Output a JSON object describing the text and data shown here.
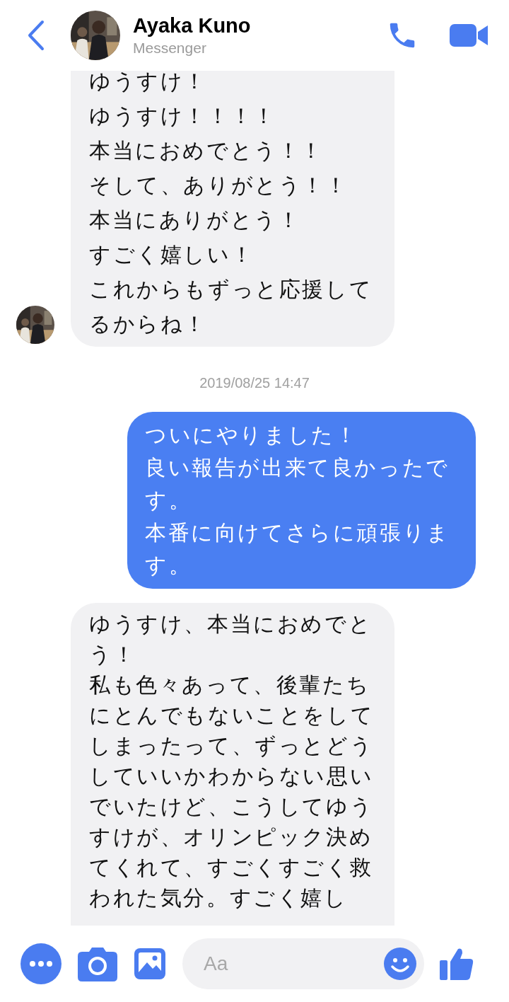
{
  "header": {
    "name": "Ayaka Kuno",
    "subtitle": "Messenger"
  },
  "messages": [
    {
      "kind": "received",
      "avatar": true,
      "lines": [
        "ゆうすけ！",
        "ゆうすけ！！！！",
        "本当におめでとう！！",
        "そして、ありがとう！！",
        "本当にありがとう！",
        "すごく嬉しい！",
        "これからもずっと応援してるからね！"
      ]
    },
    {
      "kind": "timestamp",
      "text": "2019/08/25 14:47"
    },
    {
      "kind": "sent",
      "lines": [
        "ついにやりました！",
        "良い報告が出来て良かったです。",
        "本番に向けてさらに頑張ります。"
      ]
    },
    {
      "kind": "received",
      "avatar": false,
      "lines": [
        "ゆうすけ、本当におめでとう！",
        "私も色々あって、後輩たちにとんでもないことをしてしまったって、ずっとどうしていいかわからない思いでいたけど、こうしてゆうすけが、オリンピック決めてくれて、すごくすごく救われた気分。すごく嬉し"
      ]
    }
  ],
  "composer": {
    "placeholder": "Aa"
  }
}
